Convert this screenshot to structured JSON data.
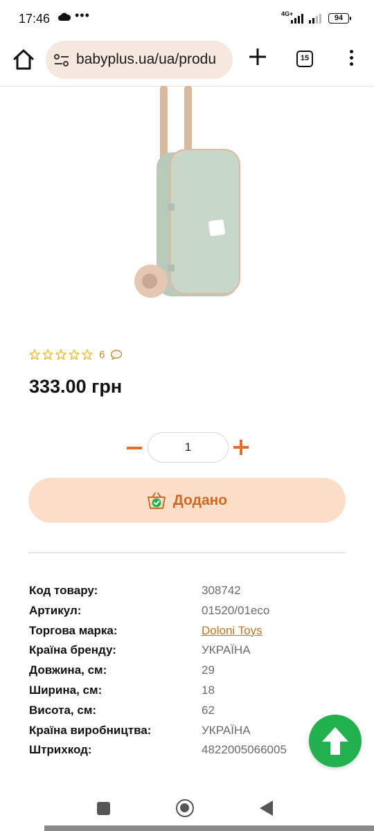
{
  "status_bar": {
    "time": "17:46",
    "dots": "•••",
    "network": "4G+",
    "battery": "94"
  },
  "browser": {
    "url": "babyplus.ua/ua/produ",
    "tab_count": "15"
  },
  "product": {
    "rating_stars": 0,
    "rating_max": 5,
    "review_count": "6",
    "price": "333.00 грн",
    "quantity": "1",
    "added_label": "Додано"
  },
  "specs": [
    {
      "label": "Код товару:",
      "value": "308742"
    },
    {
      "label": "Артикул:",
      "value": "01520/01eco"
    },
    {
      "label": "Торгова марка:",
      "value": "Doloni Toys",
      "link": true
    },
    {
      "label": "Країна бренду:",
      "value": "УКРАЇНА"
    },
    {
      "label": "Довжина, см:",
      "value": "29"
    },
    {
      "label": "Ширина, см:",
      "value": "18"
    },
    {
      "label": "Висота, см:",
      "value": "62"
    },
    {
      "label": "Країна виробництва:",
      "value": "УКРАЇНА"
    },
    {
      "label": "Штрихкод:",
      "value": "4822005066005"
    }
  ],
  "colors": {
    "accent_orange": "#e0712b",
    "button_bg": "#fddfc9",
    "scroll_top_green": "#22b14c",
    "link": "#c2741f"
  }
}
